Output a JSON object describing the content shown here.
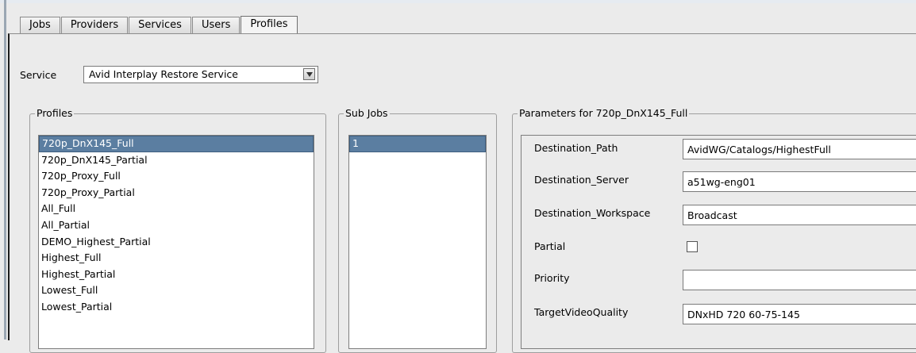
{
  "tabs": [
    "Jobs",
    "Providers",
    "Services",
    "Users",
    "Profiles"
  ],
  "active_tab": "Profiles",
  "service": {
    "label": "Service",
    "selected": "Avid Interplay Restore Service"
  },
  "profiles": {
    "legend": "Profiles",
    "items": [
      "720p_DnX145_Full",
      "720p_DnX145_Partial",
      "720p_Proxy_Full",
      "720p_Proxy_Partial",
      "All_Full",
      "All_Partial",
      "DEMO_Highest_Partial",
      "Highest_Full",
      "Highest_Partial",
      "Lowest_Full",
      "Lowest_Partial"
    ],
    "selected": "720p_DnX145_Full"
  },
  "sub_jobs": {
    "legend": "Sub Jobs",
    "items": [
      "1"
    ],
    "selected": "1"
  },
  "parameters": {
    "legend": "Parameters for 720p_DnX145_Full",
    "rows": [
      {
        "label": "Destination_Path",
        "value": "AvidWG/Catalogs/HighestFull"
      },
      {
        "label": "Destination_Server",
        "value": "a51wg-eng01"
      },
      {
        "label": "Destination_Workspace",
        "value": "Broadcast"
      },
      {
        "label": "Partial",
        "checked": false
      },
      {
        "label": "Priority",
        "value": ""
      },
      {
        "label": "TargetVideoQuality",
        "value": "DNxHD 720 60-75-145"
      }
    ]
  },
  "colors": {
    "selection": "#5b7ea1",
    "background": "#ebebeb"
  },
  "icons": {
    "dropdown": "chevron-down-icon",
    "checkbox": "checkbox-icon"
  }
}
